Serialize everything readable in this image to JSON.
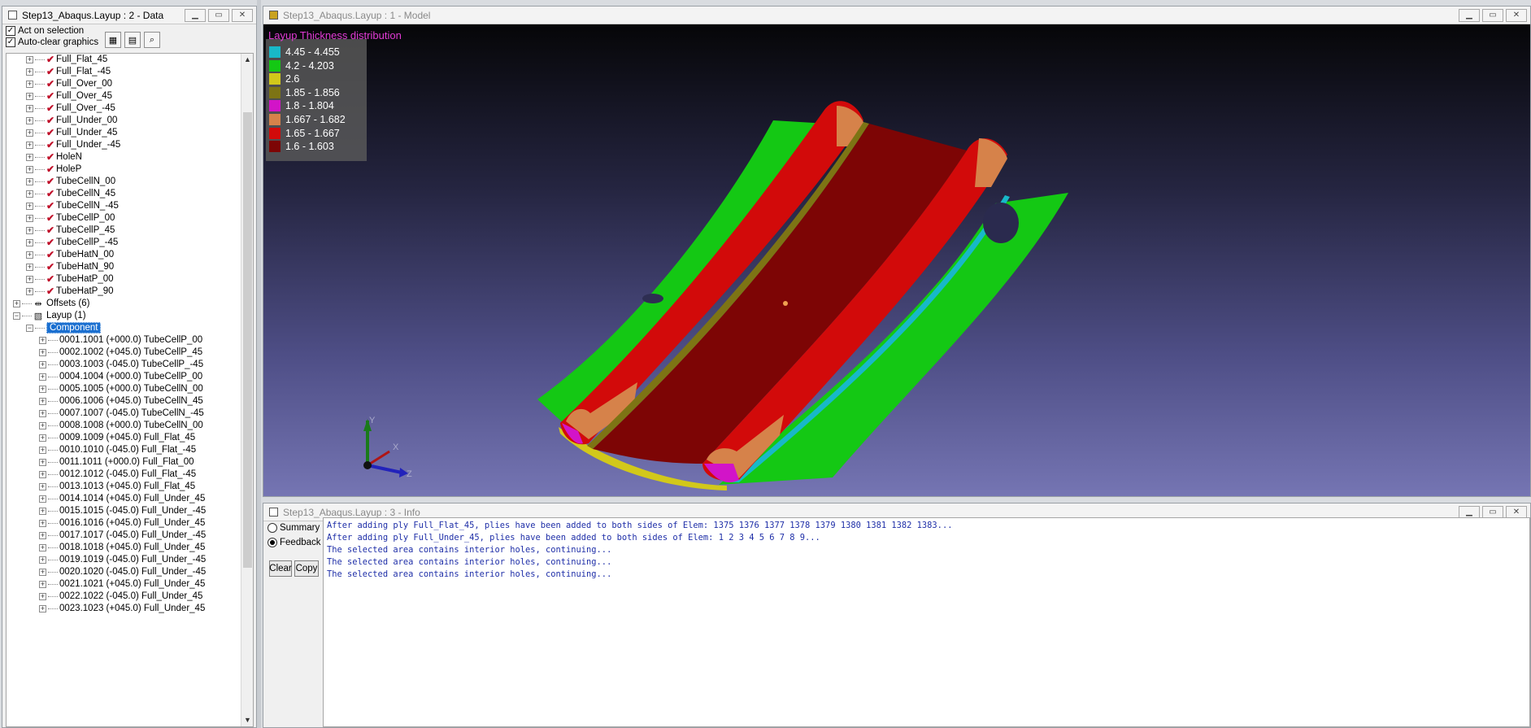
{
  "data_window": {
    "title": "Step13_Abaqus.Layup : 2 - Data",
    "act_on_selection": "Act on selection",
    "auto_clear": "Auto-clear graphics",
    "tree": {
      "plies": [
        "Full_Flat_45",
        "Full_Flat_-45",
        "Full_Over_00",
        "Full_Over_45",
        "Full_Over_-45",
        "Full_Under_00",
        "Full_Under_45",
        "Full_Under_-45",
        "HoleN",
        "HoleP",
        "TubeCellN_00",
        "TubeCellN_45",
        "TubeCellN_-45",
        "TubeCellP_00",
        "TubeCellP_45",
        "TubeCellP_-45",
        "TubeHatN_00",
        "TubeHatN_90",
        "TubeHatP_00",
        "TubeHatP_90"
      ],
      "offsets": "Offsets (6)",
      "layup": "Layup (1)",
      "component": "Component",
      "sequence": [
        "0001.1001 (+000.0)  TubeCellP_00",
        "0002.1002 (+045.0)  TubeCellP_45",
        "0003.1003 (-045.0)  TubeCellP_-45",
        "0004.1004 (+000.0)  TubeCellP_00",
        "0005.1005 (+000.0)  TubeCellN_00",
        "0006.1006 (+045.0)  TubeCellN_45",
        "0007.1007 (-045.0)  TubeCellN_-45",
        "0008.1008 (+000.0)  TubeCellN_00",
        "0009.1009 (+045.0)  Full_Flat_45",
        "0010.1010 (-045.0)  Full_Flat_-45",
        "0011.1011 (+000.0)  Full_Flat_00",
        "0012.1012 (-045.0)  Full_Flat_-45",
        "0013.1013 (+045.0)  Full_Flat_45",
        "0014.1014 (+045.0)  Full_Under_45",
        "0015.1015 (-045.0)  Full_Under_-45",
        "0016.1016 (+045.0)  Full_Under_45",
        "0017.1017 (-045.0)  Full_Under_-45",
        "0018.1018 (+045.0)  Full_Under_45",
        "0019.1019 (-045.0)  Full_Under_-45",
        "0020.1020 (-045.0)  Full_Under_-45",
        "0021.1021 (+045.0)  Full_Under_45",
        "0022.1022 (-045.0)  Full_Under_45",
        "0023.1023 (+045.0)  Full_Under_45"
      ]
    }
  },
  "model_window": {
    "title": "Step13_Abaqus.Layup : 1 - Model",
    "viewport_title": "Layup Thickness distribution",
    "legend": [
      {
        "label": "4.45 - 4.455",
        "color": "#18b8c8"
      },
      {
        "label": "4.2 - 4.203",
        "color": "#14c814"
      },
      {
        "label": "2.6",
        "color": "#d2c81a"
      },
      {
        "label": "1.85 - 1.856",
        "color": "#7d7414"
      },
      {
        "label": "1.8 - 1.804",
        "color": "#d214c8"
      },
      {
        "label": "1.667 - 1.682",
        "color": "#d6824a"
      },
      {
        "label": "1.65 - 1.667",
        "color": "#d20a0a"
      },
      {
        "label": "1.6 - 1.603",
        "color": "#7d0505"
      }
    ],
    "triad": {
      "x": "X",
      "y": "Y",
      "z": "Z"
    }
  },
  "info_window": {
    "title": "Step13_Abaqus.Layup : 3 - Info",
    "summary": "Summary",
    "feedback": "Feedback",
    "clear": "Clear",
    "copy": "Copy",
    "log": [
      "After adding ply Full_Flat_45, plies have been added to both sides of Elem: 1375 1376 1377 1378 1379 1380 1381 1382 1383...",
      "After adding ply Full_Under_45, plies have been added to both sides of Elem: 1 2 3 4 5 6 7 8 9...",
      "The selected area contains interior holes, continuing...",
      "The selected area contains interior holes, continuing...",
      "The selected area contains interior holes, continuing..."
    ]
  }
}
